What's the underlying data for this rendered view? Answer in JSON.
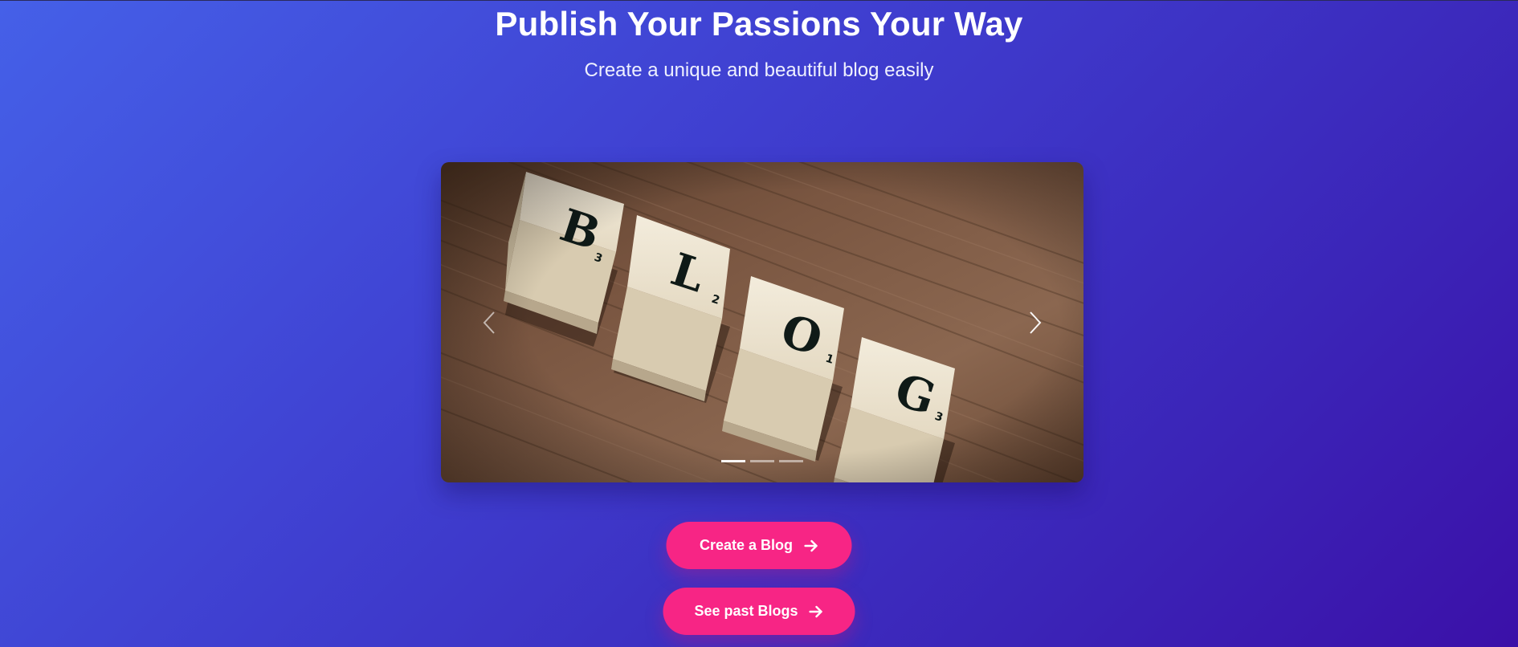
{
  "hero": {
    "title": "Publish Your Passions Your Way",
    "subtitle": "Create a unique and beautiful blog easily"
  },
  "carousel": {
    "image_icon": "blog-scrabble-tiles-image",
    "tiles": [
      {
        "letter": "B",
        "score": "3"
      },
      {
        "letter": "L",
        "score": "2"
      },
      {
        "letter": "O",
        "score": "1"
      },
      {
        "letter": "G",
        "score": "3"
      }
    ],
    "prev_icon": "chevron-left-icon",
    "next_icon": "chevron-right-icon",
    "slide_count": 3,
    "active_slide": 1
  },
  "actions": {
    "create_label": "Create a Blog",
    "past_label": "See past Blogs",
    "arrow_icon": "arrow-right-icon"
  },
  "colors": {
    "accent": "#f72585",
    "background_start": "#4560e8",
    "background_end": "#3b10a8"
  }
}
